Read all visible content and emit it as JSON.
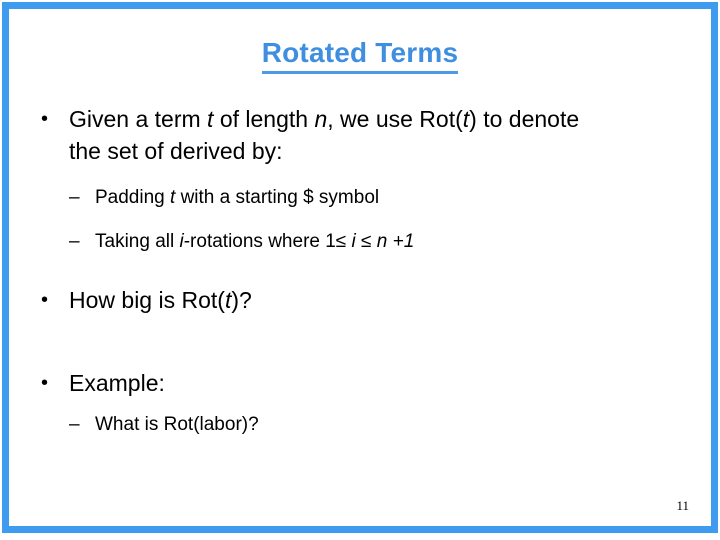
{
  "slide": {
    "title": "Rotated Terms",
    "title_color": "#3f8fe0",
    "frame_color": "#3f9bf0",
    "background": "#ffffff",
    "page_number": "11",
    "bullets": [
      {
        "level": 1,
        "marker": "•",
        "line1_pre": "Given a term ",
        "line1_var1": "t",
        "line1_mid": " of length ",
        "line1_var2": "n",
        "line1_post": ", we use Rot(",
        "line1_var3": "t",
        "line1_end": ") to denote",
        "line2": "the set of derived by:"
      },
      {
        "level": 2,
        "marker": "–",
        "pre": "Padding ",
        "var": "t",
        "post": " with a starting $ symbol"
      },
      {
        "level": 2,
        "marker": "–",
        "pre": "Taking all ",
        "var1": "i",
        "mid": "-rotations where 1≤ ",
        "var2": "i",
        "mid2": " ≤ ",
        "var3": "n",
        "post": " +1"
      },
      {
        "level": 1,
        "marker": "•",
        "pre": "How big is Rot(",
        "var": "t",
        "post": ")?"
      },
      {
        "level": 1,
        "marker": "•",
        "text": "Example:"
      },
      {
        "level": 2,
        "marker": "–",
        "text": "What is Rot(labor)?"
      }
    ]
  }
}
